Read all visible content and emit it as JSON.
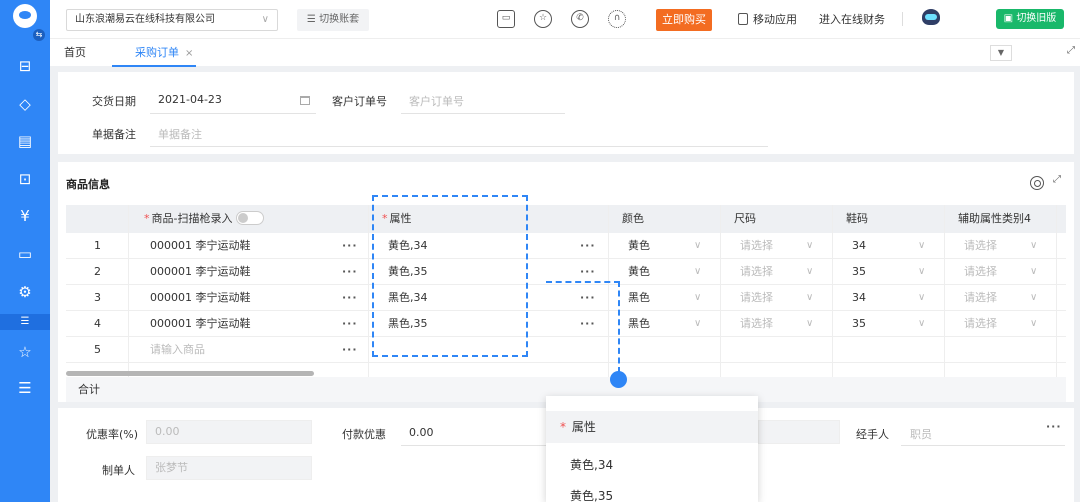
{
  "topbar": {
    "company": "山东浪潮易云在线科技有限公司",
    "switch_account": "切换账套",
    "buy_now": "立即购买",
    "mobile_app": "移动应用",
    "online_finance": "进入在线财务",
    "switch_old": "切换旧版"
  },
  "tabs": {
    "home": "首页",
    "purchase_order": "采购订单",
    "close": "×"
  },
  "form_top": {
    "delivery_date_label": "交货日期",
    "delivery_date_value": "2021-04-23",
    "customer_order_label": "客户订单号",
    "customer_order_placeholder": "客户订单号",
    "remark_label": "单据备注",
    "remark_placeholder": "单据备注"
  },
  "goods": {
    "title": "商品信息",
    "columns": {
      "product": "商品-扫描枪录入",
      "attribute": "属性",
      "color": "颜色",
      "size": "尺码",
      "shoe_size": "鞋码",
      "aux_attr": "辅助属性类别4"
    },
    "rows": [
      {
        "no": "1",
        "product": "000001 李宁运动鞋",
        "attr": "黄色,34",
        "color": "黄色",
        "size": "请选择",
        "shoe": "34",
        "aux": "请选择"
      },
      {
        "no": "2",
        "product": "000001 李宁运动鞋",
        "attr": "黄色,35",
        "color": "黄色",
        "size": "请选择",
        "shoe": "35",
        "aux": "请选择"
      },
      {
        "no": "3",
        "product": "000001 李宁运动鞋",
        "attr": "黑色,34",
        "color": "黑色",
        "size": "请选择",
        "shoe": "34",
        "aux": "请选择"
      },
      {
        "no": "4",
        "product": "000001 李宁运动鞋",
        "attr": "黑色,35",
        "color": "黑色",
        "size": "请选择",
        "shoe": "35",
        "aux": "请选择"
      }
    ],
    "new_row": {
      "no": "5",
      "placeholder": "请输入商品"
    },
    "total_label": "合计"
  },
  "form_bottom": {
    "discount_rate_label": "优惠率(%)",
    "discount_rate_value": "0.00",
    "payment_discount_label": "付款优惠",
    "payment_discount_value": "0.00",
    "handler_label": "经手人",
    "handler_placeholder": "职员",
    "maker_label": "制单人",
    "maker_value": "张梦节"
  },
  "popup": {
    "header": "属性",
    "options": [
      "黄色,34",
      "黄色,35"
    ]
  },
  "colors": {
    "primary": "#2f86f6",
    "buy": "#f36c21",
    "old_version": "#19b86a"
  }
}
